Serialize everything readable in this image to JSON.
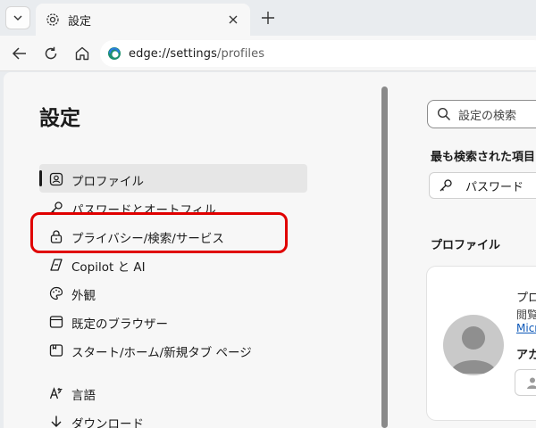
{
  "tab": {
    "title": "設定"
  },
  "address": {
    "host": "edge://settings",
    "path": "/profiles"
  },
  "settings": {
    "title": "設定",
    "nav": [
      {
        "label": "プロファイル",
        "icon": "profile-icon",
        "active": true
      },
      {
        "label": "パスワードとオートフィル",
        "icon": "key-icon"
      },
      {
        "label": "プライバシー/検索/サービス",
        "icon": "lock-icon",
        "highlighted": true
      },
      {
        "label": "Copilot と AI",
        "icon": "copilot-icon"
      },
      {
        "label": "外観",
        "icon": "palette-icon"
      },
      {
        "label": "既定のブラウザー",
        "icon": "browser-window-icon"
      },
      {
        "label": "スタート/ホーム/新規タブ ページ",
        "icon": "start-page-icon"
      },
      {
        "label": "言語",
        "icon": "language-icon"
      },
      {
        "label": "ダウンロード",
        "icon": "download-icon"
      }
    ]
  },
  "search": {
    "placeholder": "設定の検索"
  },
  "most_searched": {
    "heading": "最も検索された項目",
    "chip": "パスワード"
  },
  "profiles": {
    "heading": "プロファイル",
    "card": {
      "name": "プロ",
      "browse": "閲覧",
      "link": "Micr",
      "account": "アカ"
    }
  },
  "colors": {
    "highlight": "#e00000",
    "link": "#0b57b8"
  }
}
